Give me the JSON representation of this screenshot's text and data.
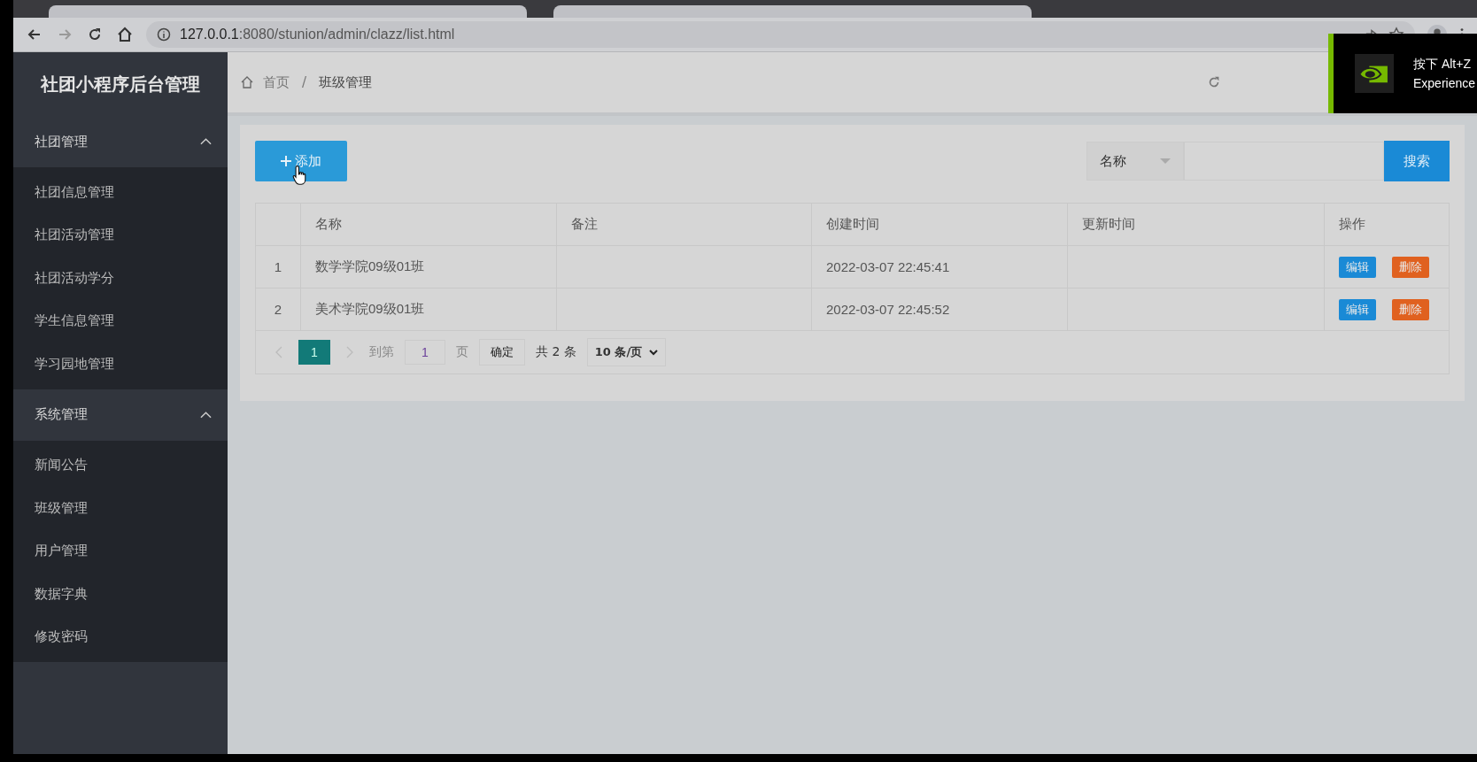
{
  "browser": {
    "url_host": "127.0.0.1",
    "url_path": ":8080/stunion/admin/clazz/list.html"
  },
  "sidebar": {
    "title": "社团小程序后台管理",
    "groups": [
      {
        "label": "社团管理",
        "expanded": true,
        "items": [
          {
            "label": "社团信息管理",
            "selected": false
          },
          {
            "label": "社团活动管理",
            "selected": false
          },
          {
            "label": "社团活动学分",
            "selected": false
          },
          {
            "label": "学生信息管理",
            "selected": false
          },
          {
            "label": "学习园地管理",
            "selected": false
          }
        ]
      },
      {
        "label": "系统管理",
        "expanded": true,
        "items": [
          {
            "label": "新闻公告",
            "selected": false
          },
          {
            "label": "班级管理",
            "selected": false
          },
          {
            "label": "用户管理",
            "selected": false
          },
          {
            "label": "数据字典",
            "selected": false
          },
          {
            "label": "修改密码",
            "selected": false
          }
        ]
      }
    ]
  },
  "breadcrumb": [
    "首页",
    "/",
    "班级管理"
  ],
  "toolbar": {
    "add_button": "添加",
    "search_field_select": "名称",
    "search_button": "搜索"
  },
  "table": {
    "columns": [
      "",
      "名称",
      "备注",
      "创建时间",
      "更新时间",
      "操作"
    ],
    "rows": [
      {
        "index": "1",
        "name": "数学学院09级01班",
        "note": "",
        "created": "2022-03-07 22:45:41",
        "updated": "",
        "edit": "编辑",
        "delete": "删除"
      },
      {
        "index": "2",
        "name": "美术学院09级01班",
        "note": "",
        "created": "2022-03-07 22:45:52",
        "updated": "",
        "edit": "编辑",
        "delete": "删除"
      }
    ]
  },
  "pagination": {
    "pages": [
      {
        "label": "1",
        "selected": true
      }
    ],
    "goto_label": "到第",
    "goto_value": "1",
    "page_unit": "页",
    "confirm": "确定",
    "total": "共 2 条",
    "page_size": "10 条/页"
  },
  "notification": {
    "line_1": "按下 Alt+Z",
    "line_2": "Experience"
  }
}
